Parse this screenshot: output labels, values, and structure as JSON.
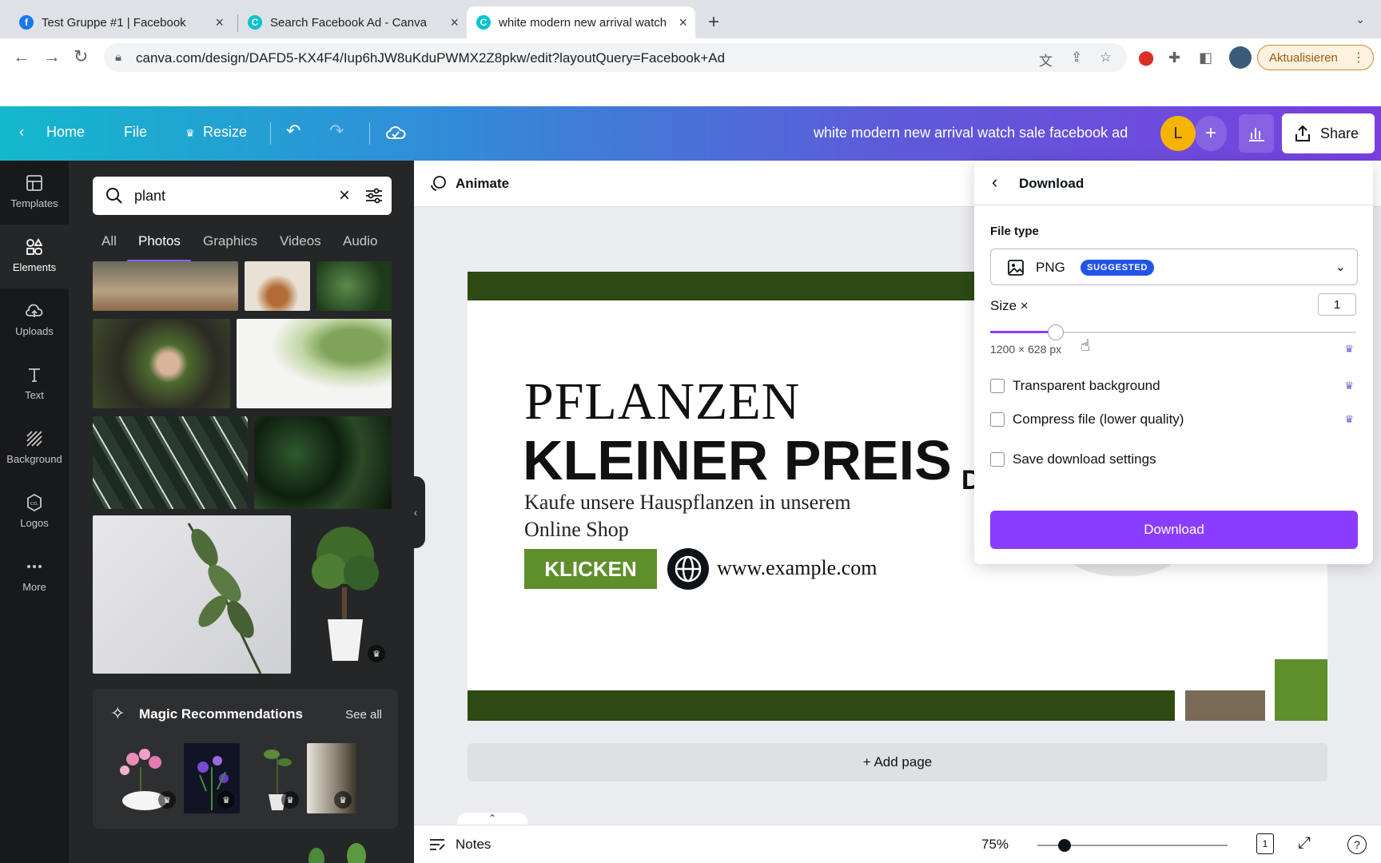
{
  "browser": {
    "tabs": [
      {
        "title": "Test Gruppe #1 | Facebook",
        "icon": "facebook-icon",
        "color": "#1877f2"
      },
      {
        "title": "Search Facebook Ad - Canva",
        "icon": "canva-icon",
        "color": "#00c4cc"
      },
      {
        "title": "white modern new arrival watch sale facebook ad",
        "icon": "canva-icon",
        "color": "#00c4cc"
      }
    ],
    "url": "canva.com/design/DAFD5-KX4F4/Iup6hJW8uKduPWMX2Z8pkw/edit?layoutQuery=Facebook+Ad",
    "update_label": "Aktualisieren"
  },
  "header": {
    "home": "Home",
    "file": "File",
    "resize": "Resize",
    "doc_title": "white modern new arrival watch sale facebook ad",
    "avatar_letter": "L",
    "share": "Share"
  },
  "rail": {
    "items": [
      {
        "label": "Templates",
        "icon": "templates-icon"
      },
      {
        "label": "Elements",
        "icon": "elements-icon"
      },
      {
        "label": "Uploads",
        "icon": "uploads-icon"
      },
      {
        "label": "Text",
        "icon": "text-icon"
      },
      {
        "label": "Background",
        "icon": "background-icon"
      },
      {
        "label": "Logos",
        "icon": "logos-icon"
      },
      {
        "label": "More",
        "icon": "more-icon"
      }
    ]
  },
  "panel": {
    "search_value": "plant",
    "tabs": [
      "All",
      "Photos",
      "Graphics",
      "Videos",
      "Audio"
    ],
    "active_tab": "Photos",
    "magic_title": "Magic Recommendations",
    "see_all": "See all"
  },
  "toolbar": {
    "animate": "Animate"
  },
  "design": {
    "headline1": "PFLANZEN",
    "headline2": "KLEINER PREIS",
    "subline1": "Kaufe unsere Hauspflanzen in unserem",
    "subline2": "Online Shop",
    "cta": "KLICKEN",
    "website": "www.example.com",
    "partial_letter": "D",
    "colors": {
      "dark_green": "#2d4a12",
      "green": "#5f8f2b",
      "brown": "#7a6a55"
    }
  },
  "add_page": "+ Add page",
  "bottom": {
    "notes": "Notes",
    "zoom": "75%",
    "page_count": "1"
  },
  "download": {
    "title": "Download",
    "file_type_label": "File type",
    "file_type": "PNG",
    "suggested": "SUGGESTED",
    "size_label": "Size ×",
    "size_value": "1",
    "size_slider_percent": 18,
    "dimensions": "1200 × 628 px",
    "options": [
      {
        "label": "Transparent background",
        "checked": false,
        "pro": true
      },
      {
        "label": "Compress file (lower quality)",
        "checked": false,
        "pro": true
      },
      {
        "label": "Save download settings",
        "checked": false,
        "pro": false
      }
    ],
    "button": "Download",
    "accent": "#8b3dff"
  }
}
